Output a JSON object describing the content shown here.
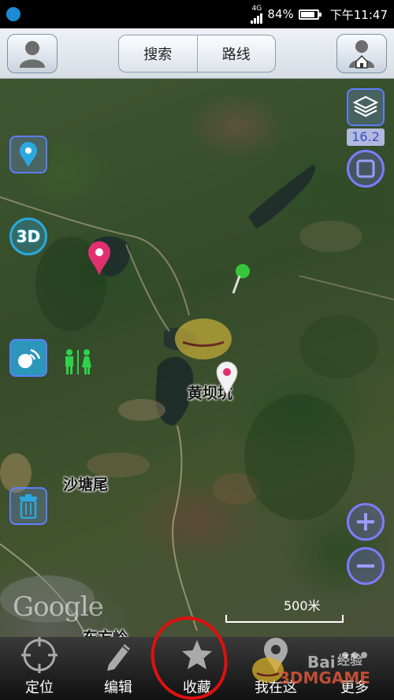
{
  "status_bar": {
    "network": "4G",
    "battery": "84%",
    "battery_level": 0.84,
    "time": "下午11:47"
  },
  "top_bar": {
    "search_label": "搜索",
    "route_label": "路线"
  },
  "map": {
    "labels": {
      "huangbakeng": "黄坝坑",
      "shatangwei": "沙塘尾",
      "bottom_partial": "东方岭"
    },
    "zoom_level": "16.2",
    "scale": "500米",
    "google_logo": "Google",
    "buttons": {
      "three_d": "3D"
    }
  },
  "bottom_nav": {
    "items": [
      {
        "label": "定位",
        "icon": "crosshair-icon"
      },
      {
        "label": "编辑",
        "icon": "pencil-icon"
      },
      {
        "label": "收藏",
        "icon": "star-icon"
      },
      {
        "label": "我在这",
        "icon": "location-pin-icon"
      },
      {
        "label": "更多",
        "icon": "more-icon"
      }
    ]
  },
  "watermark": {
    "brand": "Bai",
    "brand_sub": "经验",
    "game": "3DMGAME"
  },
  "colors": {
    "highlight": "#e01010",
    "map_button": "#5c7fff",
    "marker_pink": "#e0306e",
    "pin_green": "#36c83a"
  }
}
